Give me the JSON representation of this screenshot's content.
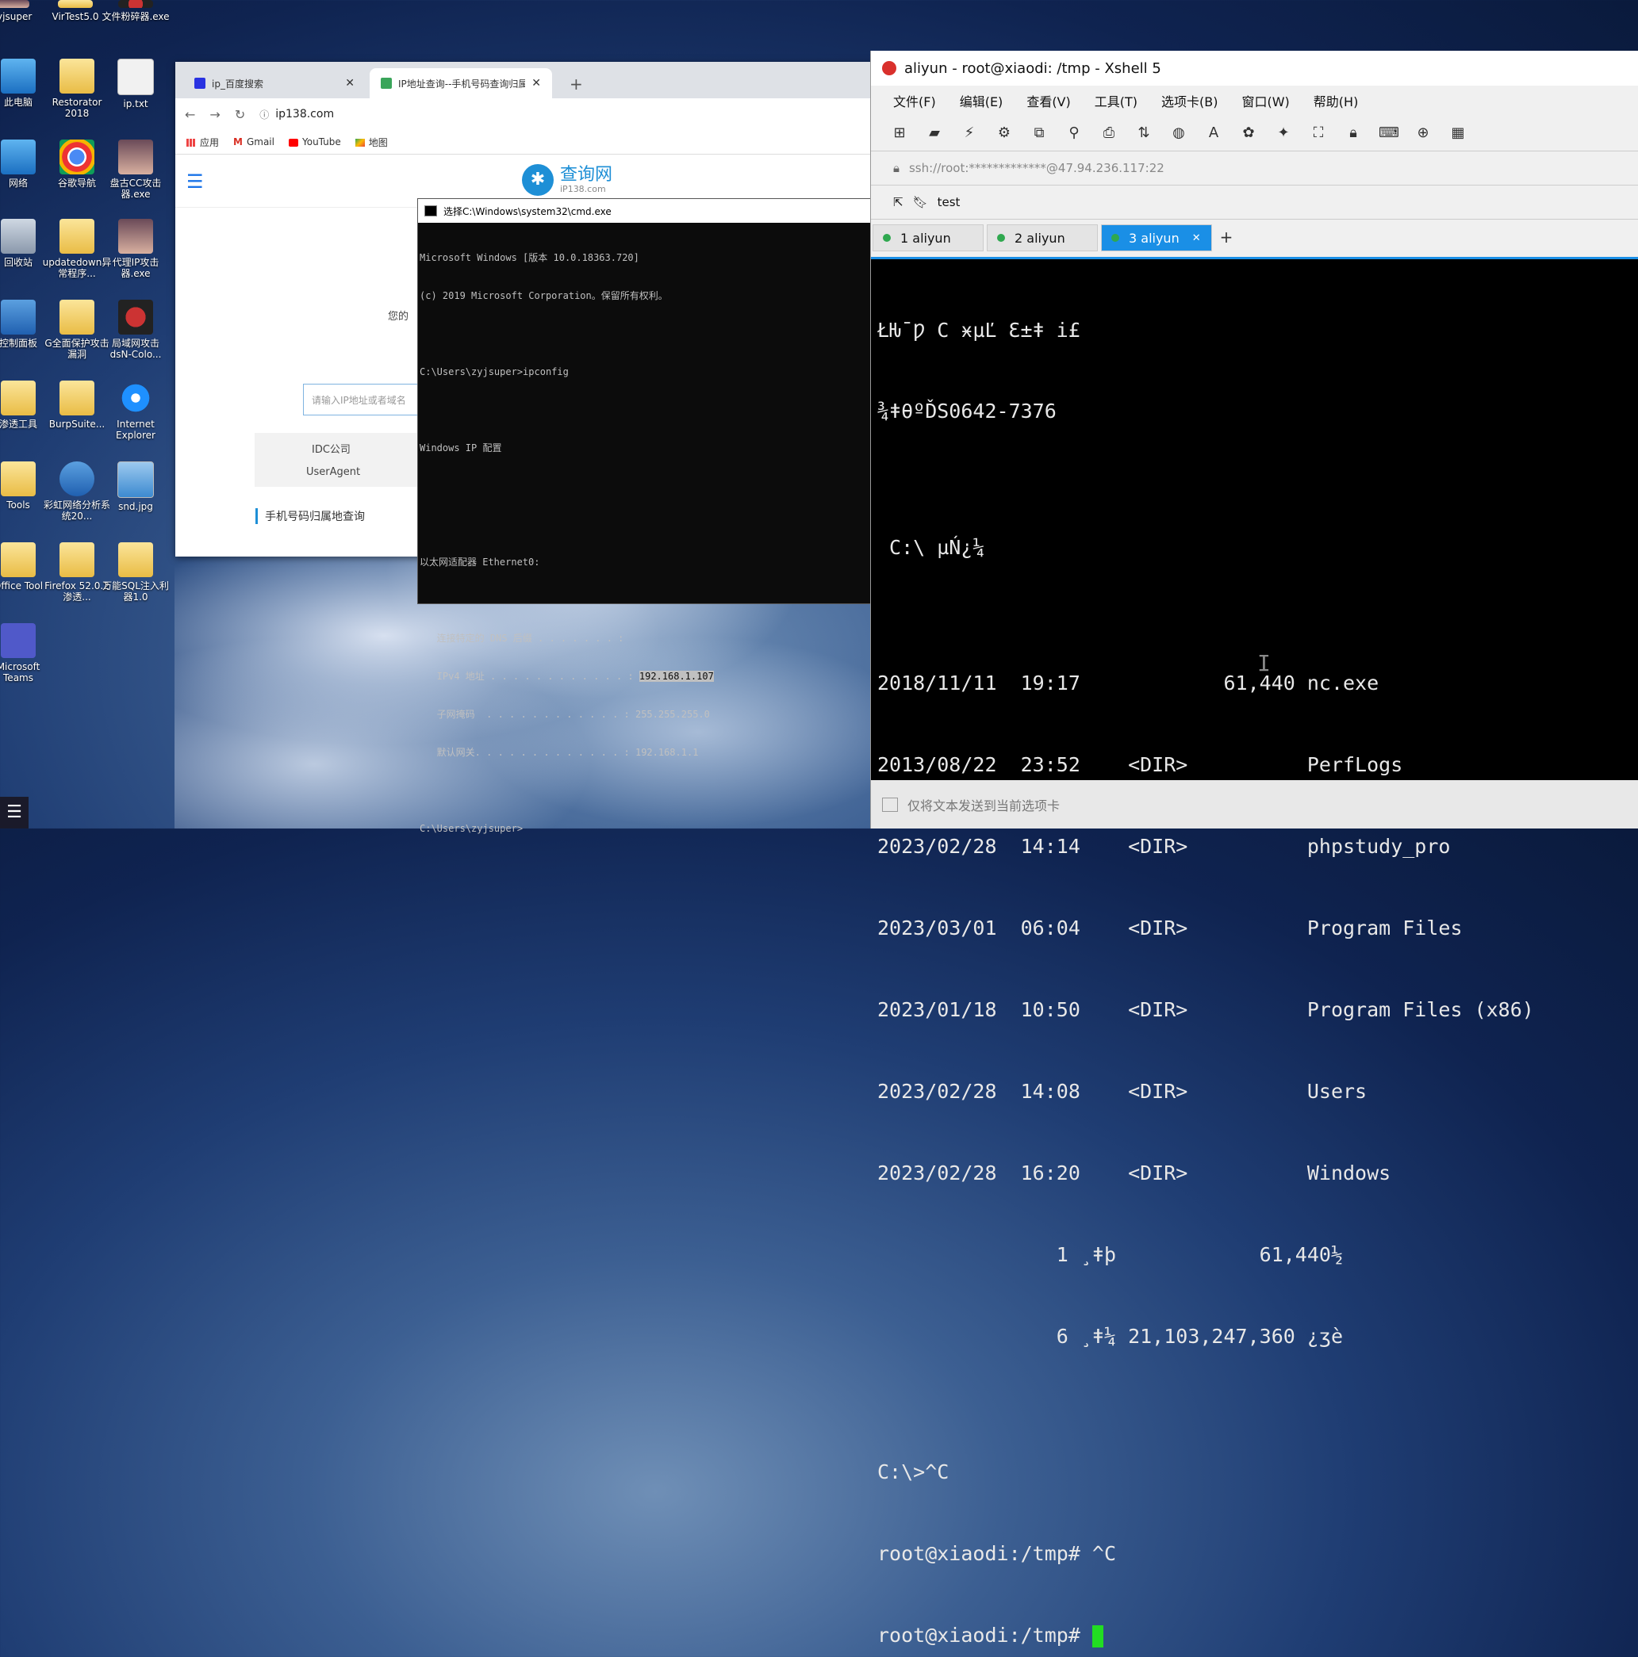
{
  "desktop": {
    "icons": [
      {
        "label": "zyjsuper"
      },
      {
        "label": "VirTest5.0"
      },
      {
        "label": "文件粉碎器.exe"
      },
      {
        "label": "此电脑"
      },
      {
        "label": "Restorator 2018"
      },
      {
        "label": "ip.txt"
      },
      {
        "label": "网络"
      },
      {
        "label": "谷歌导航"
      },
      {
        "label": "盘古CC攻击器.exe"
      },
      {
        "label": "回收站"
      },
      {
        "label": "updatedown异常程序..."
      },
      {
        "label": "代理IP攻击器.exe"
      },
      {
        "label": "控制面板"
      },
      {
        "label": "G全面保护攻击漏洞"
      },
      {
        "label": "局域网攻击 dsN-Colo..."
      },
      {
        "label": "渗透工具"
      },
      {
        "label": "BurpSuite..."
      },
      {
        "label": "Internet Explorer"
      },
      {
        "label": "Tools"
      },
      {
        "label": "彩虹网络分析系统20..."
      },
      {
        "label": "snd.jpg"
      },
      {
        "label": "Office Tool"
      },
      {
        "label": "Firefox 52.0.2 渗透..."
      },
      {
        "label": "万能SQL注入利器1.0"
      },
      {
        "label": "Microsoft Teams"
      }
    ]
  },
  "browser": {
    "tabs": [
      {
        "label": "ip_百度搜索"
      },
      {
        "label": "IP地址查询--手机号码查询归属地"
      }
    ],
    "url": "ip138.com",
    "bookmarks": [
      "应用",
      "Gmail",
      "YouTube",
      "地图"
    ],
    "site_name": "查询网",
    "site_domain": "iP138.com",
    "side_text": "您的",
    "search_placeholder": "请输入IP地址或者域名",
    "idc_label": "IDC公司",
    "useragent_label": "UserAgent",
    "phone_link": "手机号码归属地查询"
  },
  "cmd": {
    "title": "选择C:\\Windows\\system32\\cmd.exe",
    "lines": [
      "Microsoft Windows [版本 10.0.18363.720]",
      "(c) 2019 Microsoft Corporation。保留所有权利。",
      "",
      "C:\\Users\\zyjsuper>ipconfig",
      "",
      "Windows IP 配置",
      "",
      "",
      "以太网适配器 Ethernet0:",
      "",
      "   连接特定的 DNS 后缀 . . . . . . . :",
      "   IPv4 地址 . . . . . . . . . . . . :",
      "   子网掩码  . . . . . . . . . . . . : 255.255.255.0",
      "   默认网关. . . . . . . . . . . . . : 192.168.1.1",
      "",
      "C:\\Users\\zyjsuper>"
    ],
    "ipv4_value": "192.168.1.107"
  },
  "xshell": {
    "title": "aliyun - root@xiaodi: /tmp - Xshell 5",
    "menu": [
      "文件(F)",
      "编辑(E)",
      "查看(V)",
      "工具(T)",
      "选项卡(B)",
      "窗口(W)",
      "帮助(H)"
    ],
    "address": "ssh://root:*************@47.94.236.117:22",
    "link": "test",
    "tabs": [
      {
        "label": "1 aliyun"
      },
      {
        "label": "2 aliyun"
      },
      {
        "label": "3 aliyun"
      }
    ],
    "terminal_lines": [
      "ŁǶ¯Ƿ C ӿµĽ Ɛ±ǂ i£",
      "¾ǂθºĎS0642-7376",
      "",
      " C:\\ µŃ¿¼",
      "",
      "2018/11/11  19:17            61,440 nc.exe",
      "2013/08/22  23:52    <DIR>          PerfLogs",
      "2023/02/28  14:14    <DIR>          phpstudy_pro",
      "2023/03/01  06:04    <DIR>          Program Files",
      "2023/01/18  10:50    <DIR>          Program Files (x86)",
      "2023/02/28  14:08    <DIR>          Users",
      "2023/02/28  16:20    <DIR>          Windows",
      "               1 ¸ǂþ            61,440½",
      "               6 ¸ǂ¼ 21,103,247,360 ¿ʒè",
      "",
      "C:\\>^C",
      "root@xiaodi:/tmp# ^C"
    ],
    "prompt": "root@xiaodi:/tmp# ",
    "status_text": "仅将文本发送到当前选项卡"
  }
}
